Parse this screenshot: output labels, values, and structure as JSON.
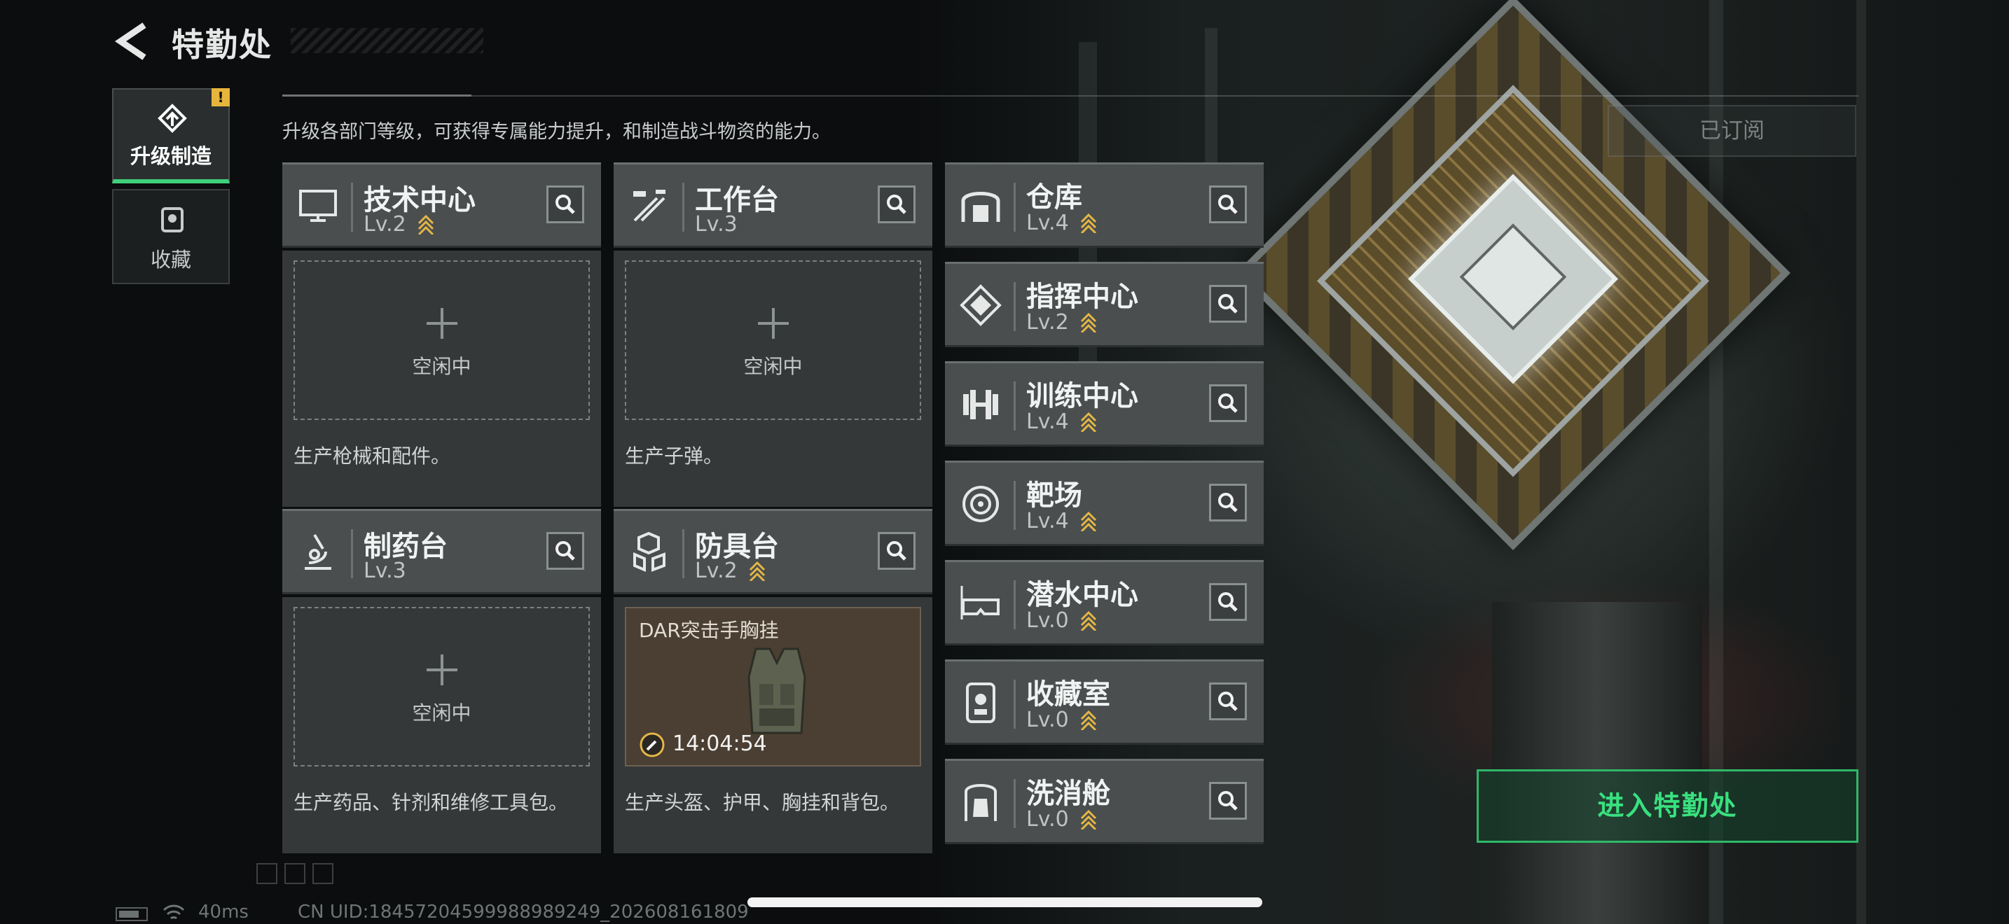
{
  "header": {
    "title": "特勤处"
  },
  "sidebar": {
    "tabs": [
      {
        "label": "升级制造",
        "active": true,
        "badge": "!"
      },
      {
        "label": "收藏",
        "active": false
      }
    ]
  },
  "main": {
    "subtitle": "升级各部门等级，可获得专属能力提升，和制造战斗物资的能力。",
    "subscribe_label": "已订阅",
    "stations": [
      {
        "name": "技术中心",
        "level": "Lv.2",
        "upgradable": true,
        "status": "空闲中",
        "description": "生产枪械和配件。",
        "icon": "monitor-icon"
      },
      {
        "name": "工作台",
        "level": "Lv.3",
        "upgradable": false,
        "status": "空闲中",
        "description": "生产子弹。",
        "icon": "tools-icon"
      },
      {
        "name": "制药台",
        "level": "Lv.3",
        "upgradable": false,
        "status": "空闲中",
        "description": "生产药品、针剂和维修工具包。",
        "icon": "microscope-icon"
      },
      {
        "name": "防具台",
        "level": "Lv.2",
        "upgradable": true,
        "description": "生产头盔、护甲、胸挂和背包。",
        "icon": "armor-icon",
        "crafting": {
          "item": "DAR突击手胸挂",
          "time_left": "14:04:54"
        }
      }
    ],
    "facilities": [
      {
        "name": "仓库",
        "level": "Lv.4",
        "upgradable": true,
        "icon": "warehouse-icon"
      },
      {
        "name": "指挥中心",
        "level": "Lv.2",
        "upgradable": true,
        "icon": "command-icon"
      },
      {
        "name": "训练中心",
        "level": "Lv.4",
        "upgradable": true,
        "icon": "dumbbell-icon"
      },
      {
        "name": "靶场",
        "level": "Lv.4",
        "upgradable": true,
        "icon": "target-icon"
      },
      {
        "name": "潜水中心",
        "level": "Lv.0",
        "upgradable": true,
        "icon": "diving-goggles-icon"
      },
      {
        "name": "收藏室",
        "level": "Lv.0",
        "upgradable": true,
        "icon": "display-case-icon"
      },
      {
        "name": "洗消舱",
        "level": "Lv.0",
        "upgradable": true,
        "icon": "decon-pod-icon"
      }
    ],
    "enter_label": "进入特勤处"
  },
  "footer": {
    "ping": "40ms",
    "uid": "CN UID:18457204599988989249_202608161809"
  },
  "colors": {
    "accent_green": "#39e07f",
    "upgrade_gold": "#e4b645",
    "alert_yellow": "#e7b53c"
  }
}
